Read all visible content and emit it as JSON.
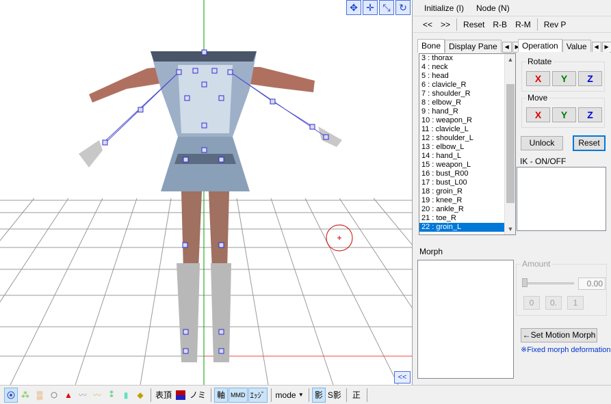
{
  "menu": {
    "initialize": "Initialize (I)",
    "node": "Node (N)"
  },
  "toolbar": {
    "prev": "<<",
    "next": ">>",
    "reset": "Reset",
    "rb": "R-B",
    "rm": "R-M",
    "revp": "Rev P"
  },
  "left_tabs": {
    "bone": "Bone",
    "display_pane": "Display Pane"
  },
  "right_tabs": {
    "operation": "Operation",
    "value": "Value"
  },
  "bones": [
    "3 : thorax",
    "4 : neck",
    "5 : head",
    "6 : clavicle_R",
    "7 : shoulder_R",
    "8 : elbow_R",
    "9 : hand_R",
    "10 : weapon_R",
    "11 : clavicle_L",
    "12 : shoulder_L",
    "13 : elbow_L",
    "14 : hand_L",
    "15 : weapon_L",
    "16 : bust_R00",
    "17 : bust_L00",
    "18 : groin_R",
    "19 : knee_R",
    "20 : ankle_R",
    "21 : toe_R",
    "22 : groin_L"
  ],
  "selected_bone": "22 : groin_L",
  "operation": {
    "rotate_label": "Rotate",
    "move_label": "Move",
    "x": "X",
    "y": "Y",
    "z": "Z",
    "x_color": "#e00000",
    "y_color": "#007a00",
    "z_color": "#0000e0"
  },
  "unlock": "Unlock",
  "reset_btn": "Reset",
  "ik_label": "IK - ON/OFF",
  "morph_label": "Morph",
  "amount_label": "Amount",
  "amount_value": "0.00",
  "morph_buttons": [
    "0",
    "0.",
    "1"
  ],
  "set_motion_morph": "←Set Motion Morph",
  "fixed_morph": "※Fixed morph deformation",
  "collapse": "<<",
  "bottom": {
    "hyouchou": "表頂",
    "nomi": "ノミ",
    "jiku": "軸",
    "mmd": "MMD",
    "edge": "ｴｯｼﾞ",
    "mode": "mode",
    "kage": "影",
    "skage": "S影",
    "sei": "正"
  },
  "icons": {
    "viewport_tools": [
      "move-view-icon",
      "move-view-all-icon",
      "zoom-icon",
      "rotate-view-icon"
    ],
    "cursor_icon": "crosshair-circle-icon"
  }
}
